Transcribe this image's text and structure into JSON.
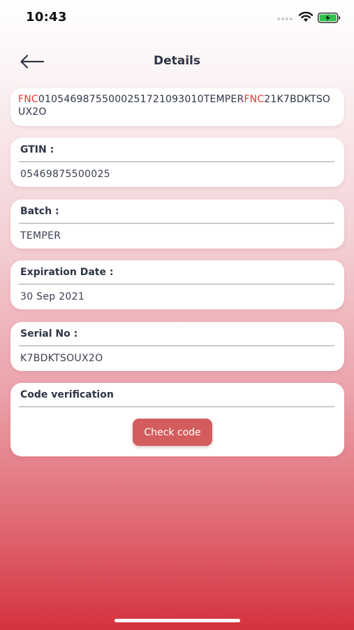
{
  "status_bar": {
    "time": "10:43"
  },
  "nav": {
    "title": "Details",
    "back_icon": "arrow-left-icon"
  },
  "code": {
    "segments": [
      {
        "text": "FNC",
        "highlight": true
      },
      {
        "text": "0105469875500025172109301​0TEMPER",
        "highlight": false
      },
      {
        "text": "FNC",
        "highlight": true
      },
      {
        "text": "21K7BDKTSOUX2O",
        "highlight": false
      }
    ]
  },
  "fields": {
    "gtin": {
      "label": "GTIN :",
      "value": "05469875500025"
    },
    "batch": {
      "label": "Batch :",
      "value": "TEMPER"
    },
    "expiration": {
      "label": "Expiration Date :",
      "value": "30 Sep 2021"
    },
    "serial": {
      "label": "Serial No :",
      "value": "K7BDKTSOUX2O"
    }
  },
  "verification": {
    "label": "Code verification",
    "button_label": "Check code"
  },
  "colors": {
    "accent": "#d35d5c",
    "highlight": "#e53935",
    "text": "#2e3547"
  }
}
